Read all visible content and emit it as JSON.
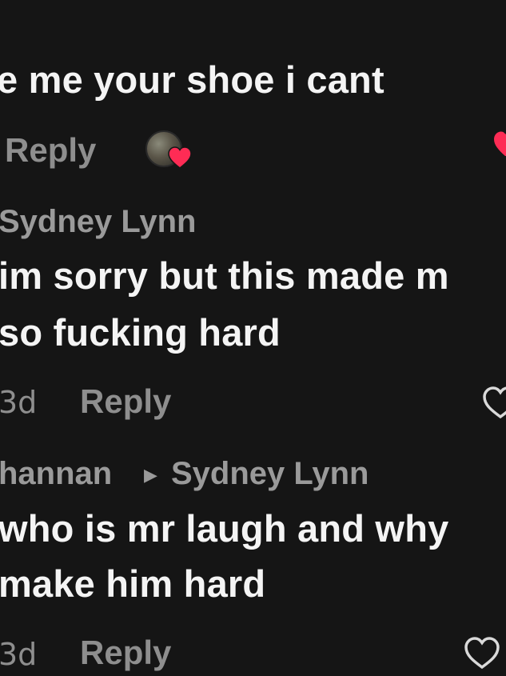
{
  "comments": {
    "first": {
      "text": "e me your shoe i cant",
      "reply_label": "Reply"
    },
    "second": {
      "author": "Sydney Lynn",
      "line1": "im sorry but this made m",
      "line2": "so fucking hard",
      "time": "3d",
      "reply_label": "Reply"
    },
    "third": {
      "author": "hannan",
      "reply_to": "Sydney Lynn",
      "line1": "who is mr laugh and why",
      "line2": "make him hard",
      "time": "3d",
      "reply_label": "Reply"
    }
  },
  "icons": {
    "liked_heart_color": "#fe2c55",
    "outline_heart_color": "#d9d9d9",
    "caret": "▶"
  }
}
